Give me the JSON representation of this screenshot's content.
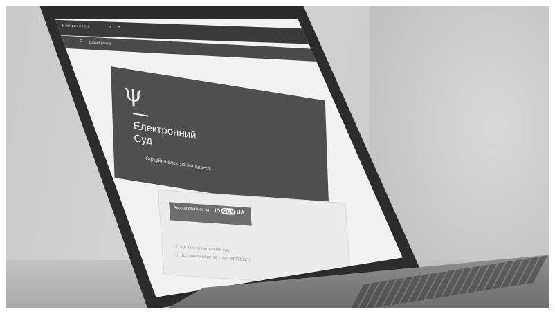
{
  "browser": {
    "tab_title": "Електронний суд",
    "tab_close": "×",
    "tab_new": "+",
    "nav_icons": "← → C",
    "url": "id.court.gov.ua"
  },
  "hero": {
    "emblem": "ψ",
    "title_line1": "Електронний",
    "title_line2": "Суд",
    "subtitle": "Офіційна електронна адреса"
  },
  "login": {
    "button_label": "Авторизуватись за",
    "idgov_prefix": "ID",
    "idgov_gov": "GOV",
    "idgov_suffix": "UA"
  },
  "faq": {
    "item1": "Що таке електронний суд",
    "item2": "Що таке особистий ключ (КЕП/ЕЦП)"
  }
}
